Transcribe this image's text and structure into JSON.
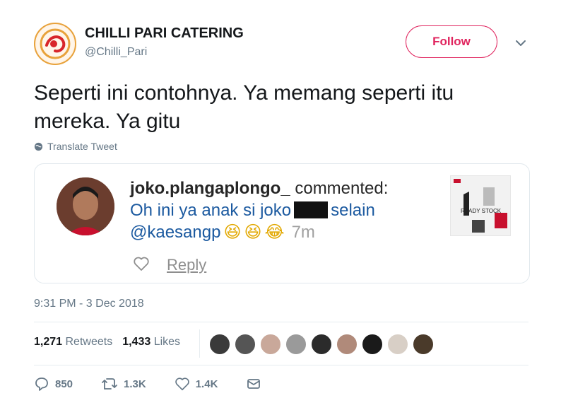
{
  "account": {
    "display_name": "CHILLI PARI CATERING",
    "handle": "@Chilli_Pari",
    "follow_label": "Follow"
  },
  "tweet": {
    "text_line1": "Seperti ini contohnya. Ya memang seperti itu",
    "text_line2": "mereka. Ya gitu",
    "translate_label": "Translate Tweet",
    "timestamp": "9:31 PM - 3 Dec 2018"
  },
  "embedded_comment": {
    "username": "joko.plangaplongo_",
    "verb": "commented:",
    "text_part1": "Oh ini ya anak si joko",
    "text_part2": "selain",
    "mention": "@kaesangp",
    "emojis": [
      "😆",
      "😆",
      "😂"
    ],
    "time": "7m",
    "reply_label": "Reply",
    "thumb_text": "READY STOCK"
  },
  "stats": {
    "retweets_count": "1,271",
    "retweets_label": "Retweets",
    "likes_count": "1,433",
    "likes_label": "Likes",
    "liker_avatars": 10
  },
  "actions": {
    "reply_count": "850",
    "retweet_count": "1.3K",
    "like_count": "1.4K"
  },
  "colors": {
    "accent": "#e0245e",
    "muted": "#657786",
    "text": "#14171a",
    "link": "#1c5aa0"
  }
}
